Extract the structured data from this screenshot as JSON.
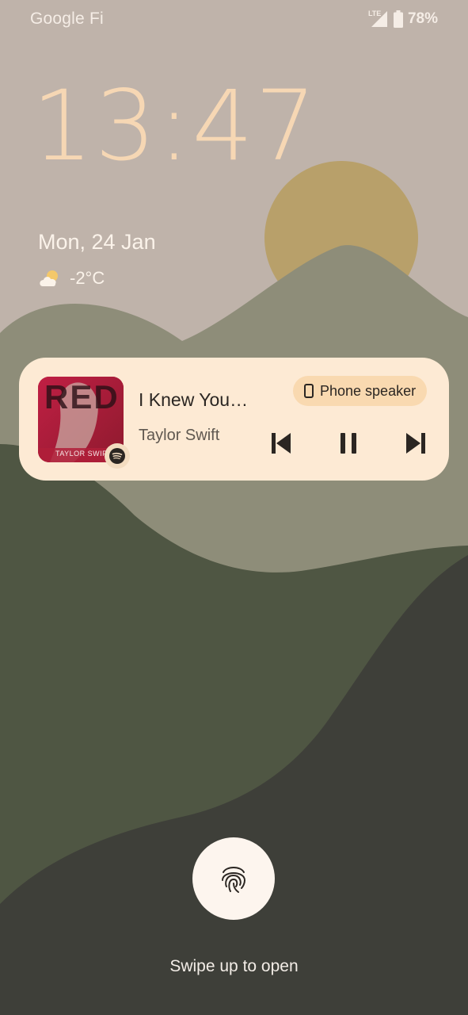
{
  "status_bar": {
    "carrier": "Google Fi",
    "network": "LTE",
    "battery": "78%",
    "icons": [
      "lte-signal-icon",
      "battery-icon"
    ]
  },
  "lockscreen": {
    "time": "13:47",
    "date": "Mon, 24 Jan",
    "weather": {
      "icon": "partly-cloudy-icon",
      "temperature": "-2°C"
    }
  },
  "media": {
    "title": "I Knew You…",
    "artist": "Taylor Swift",
    "album_art_text": "RED",
    "album_art_subtext": "TAYLOR SWIFT",
    "app_icon": "spotify-icon",
    "output_device": "Phone speaker",
    "controls": [
      "previous-icon",
      "pause-icon",
      "next-icon"
    ]
  },
  "unlock": {
    "icon": "fingerprint-icon",
    "hint": "Swipe up to open"
  },
  "colors": {
    "clock": "#f6d7b4",
    "card": "#fdead4",
    "chip": "#f9d9b0",
    "sun": "#b8a06a"
  }
}
